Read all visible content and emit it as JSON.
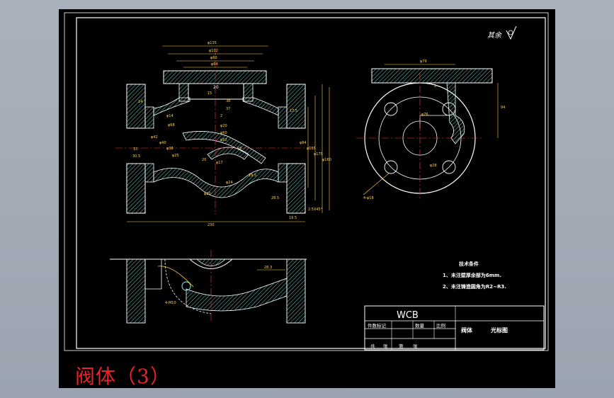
{
  "caption": "阀体（3）",
  "surface_finish_note": "其余",
  "tech_requirements": {
    "heading": "技术条件",
    "items": [
      "1、未注壁厚余部为6mm.",
      "2、未注铸造圆角为R2~R3."
    ]
  },
  "title_block": {
    "material": "WCB",
    "part_name": "阀体",
    "drawing_title": "光标图",
    "headers": [
      "件数标记",
      "数量",
      "比例"
    ],
    "footer": [
      "共",
      "张",
      "第",
      "张"
    ]
  },
  "dimensions": {
    "front": [
      "φ135",
      "φ102",
      "φ80",
      "φ64",
      "20",
      "38",
      "37",
      "2",
      "15",
      "φ20",
      "φ60",
      "φ62",
      "33",
      "30.5",
      "φ42",
      "φ40",
      "φ38",
      "φ25",
      "φ20",
      "φ17",
      "φ24",
      "19.5",
      "20",
      "R6",
      "φ14",
      "φ68",
      "14",
      "17.5",
      "φ84",
      "φ155",
      "φ175",
      "φ160",
      "28.5",
      "2.5X45°",
      "19.5",
      "230"
    ],
    "side": [
      "φ79",
      "2",
      "94",
      "φ76",
      "φ28",
      "4-φ18"
    ],
    "bottom": [
      "28.3",
      "4-M10"
    ]
  },
  "colors": {
    "background": "#000000",
    "lines": "#ffffff",
    "hatch": "#6fd0c8",
    "dims": "#ffd24a",
    "caption": "#e8232a",
    "center_lines": "#ff3b3b"
  }
}
